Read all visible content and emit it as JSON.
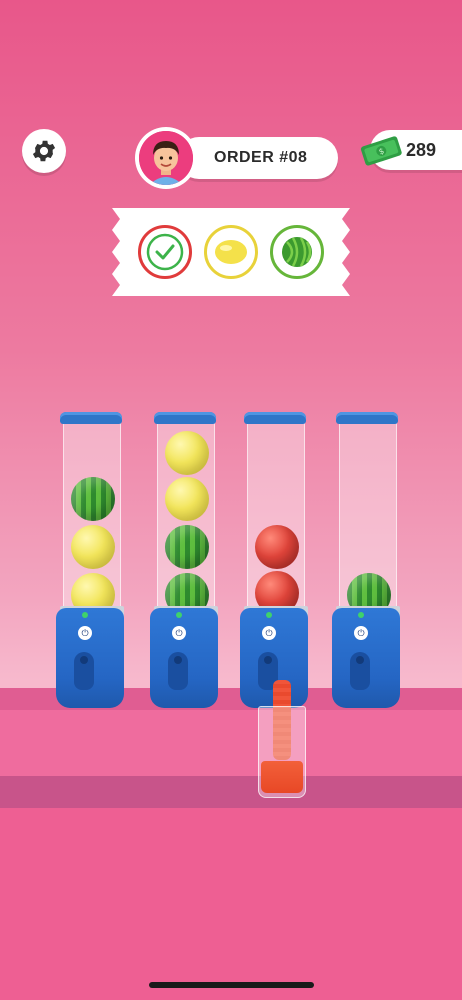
{
  "header": {
    "order_label": "ORDER #08",
    "money": "289"
  },
  "icons": {
    "settings": "gear-icon",
    "money": "cash-icon",
    "avatar": "customer-avatar"
  },
  "order_items": [
    {
      "name": "checkmark",
      "status": "done"
    },
    {
      "name": "lemon",
      "status": "pending"
    },
    {
      "name": "watermelon",
      "status": "pending"
    }
  ],
  "blenders": [
    {
      "fruits": [
        "lemon",
        "lemon",
        "watermelon"
      ]
    },
    {
      "fruits": [
        "watermelon",
        "watermelon",
        "lemon",
        "lemon"
      ]
    },
    {
      "fruits": [
        "apple",
        "apple"
      ]
    },
    {
      "fruits": [
        "watermelon"
      ]
    }
  ],
  "colors": {
    "background": "#e8578a",
    "blender_blue": "#2f78d6",
    "juice": "#e84826",
    "check_red": "#e03b3b",
    "lemon_yellow": "#e8d23a",
    "melon_green": "#66b63a"
  }
}
